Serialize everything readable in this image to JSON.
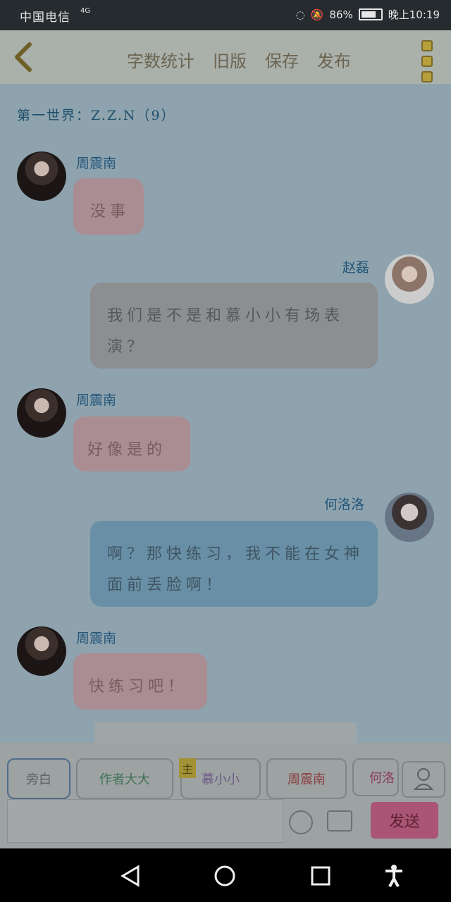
{
  "status": {
    "carrier": "中国电信",
    "network": "4G",
    "battery": "86%",
    "time": "晚上10:19"
  },
  "toolbar": {
    "word_count": "字数统计",
    "old_version": "旧版",
    "save": "保存",
    "publish": "发布"
  },
  "chat": {
    "world_label": "第一世界：Z.Z.N（9）",
    "messages": [
      {
        "sender": "周震南",
        "text": "没事"
      },
      {
        "sender": "赵磊",
        "text": "我们是不是和慕小小有场表演？"
      },
      {
        "sender": "周震南",
        "text": "好像是的"
      },
      {
        "sender": "何洛洛",
        "text": "啊？那快练习，我不能在女神面前丢脸啊！"
      },
      {
        "sender": "周震南",
        "text": "快练习吧！"
      }
    ]
  },
  "cast_bar": {
    "items": [
      {
        "label": "旁白"
      },
      {
        "label": "作者大大"
      },
      {
        "label": "慕小小",
        "tag": "主"
      },
      {
        "label": "周震南"
      },
      {
        "label": "何洛"
      }
    ]
  },
  "input": {
    "placeholder": "",
    "send_label": "发送"
  },
  "colors": {
    "send": "#aa5574",
    "pink_bubble": "#a98d93",
    "blue_bubble": "#688fa5",
    "gray_bubble": "#8c8e91"
  }
}
